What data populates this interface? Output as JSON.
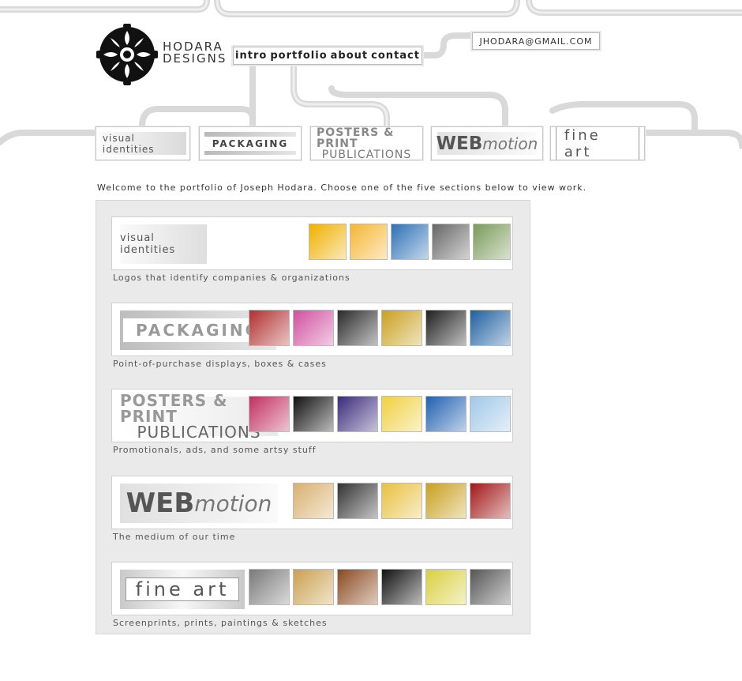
{
  "brand": {
    "line1": "HODARA",
    "line2": "DESIGNS"
  },
  "nav": {
    "items": [
      "intro",
      "portfolio",
      "about",
      "contact"
    ]
  },
  "email": "JHODARA@GMAIL.COM",
  "tabs": {
    "visual": "visual identities",
    "packaging": "PACKAGING",
    "posters_l1": "POSTERS & PRINT",
    "posters_l2": "PUBLICATIONS",
    "web": "WEB",
    "motion": "motion",
    "fine_art": "fine art"
  },
  "welcome": "Welcome to the portfolio of Joseph Hodara. Choose one of the five sections below to view work.",
  "sections": [
    {
      "title": "visual identities",
      "desc": "Logos that identify companies & organizations",
      "thumbs": [
        "#f0b000",
        "#f5b632",
        "#2e70b5",
        "#666666",
        "#7a9a5a"
      ]
    },
    {
      "title": "PACKAGING",
      "desc": "Point-of-purchase displays, boxes & cases",
      "thumbs": [
        "#b03030",
        "#d050a0",
        "#2a2a2a",
        "#c9a020",
        "#202020",
        "#1f5fa0"
      ]
    },
    {
      "title_l1": "POSTERS & PRINT",
      "title_l2": "PUBLICATIONS",
      "desc": "Promotionals, ads, and some artsy stuff",
      "thumbs": [
        "#c03060",
        "#111111",
        "#3a2b7a",
        "#f0d040",
        "#2060b0",
        "#a0c8e8"
      ]
    },
    {
      "title_web": "WEB",
      "title_motion": "motion",
      "desc": "The medium of our time",
      "thumbs": [
        "#d8b070",
        "#333333",
        "#e8c040",
        "#c8a020",
        "#a01818"
      ]
    },
    {
      "title": "fine art",
      "desc": "Screenprints, prints, paintings & sketches",
      "thumbs": [
        "#7a7a7a",
        "#caa050",
        "#8a4a20",
        "#111111",
        "#d8d040",
        "#555555"
      ]
    }
  ],
  "colors": {
    "panel": "#eaeaea",
    "pipe": "#d7d7d7"
  }
}
